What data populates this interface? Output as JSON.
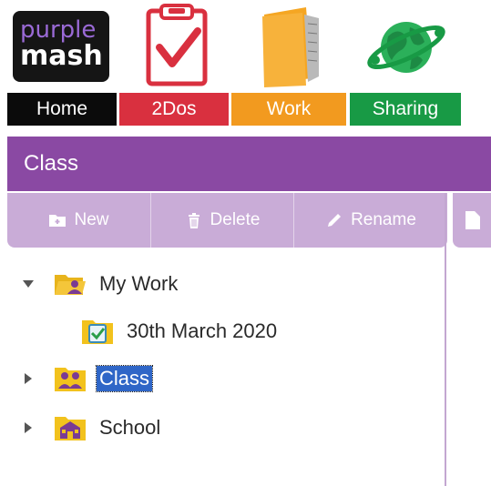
{
  "logo": {
    "line1": "purple",
    "line2": "mash"
  },
  "nav": {
    "home": {
      "label": "Home",
      "color": "#0b0b0b"
    },
    "todos": {
      "label": "2Dos",
      "color": "#d9303f"
    },
    "work": {
      "label": "Work",
      "color": "#f29a1f"
    },
    "sharing": {
      "label": "Sharing",
      "color": "#189a45"
    }
  },
  "window": {
    "title": "Class",
    "accent": "#8a49a3",
    "toolbar": {
      "new_label": "New",
      "delete_label": "Delete",
      "rename_label": "Rename"
    }
  },
  "tree": [
    {
      "label": "My Work",
      "icon": "folder-open-user-icon",
      "expanded": true
    },
    {
      "label": "30th March 2020",
      "icon": "todo-folder-icon"
    },
    {
      "label": "Class",
      "icon": "class-folder-icon",
      "selected": true
    },
    {
      "label": "School",
      "icon": "school-folder-icon"
    }
  ]
}
